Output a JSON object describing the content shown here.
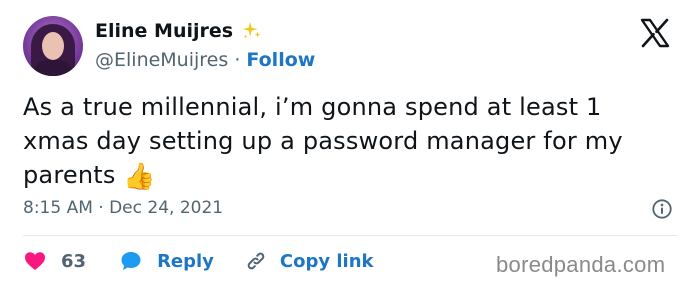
{
  "author": {
    "display_name": "Eline Muijres",
    "handle": "@ElineMuijres",
    "separator": "·",
    "follow_label": "Follow",
    "verified_icon": "sparkle-icon"
  },
  "tweet": {
    "text": "As a true millennial, i’m gonna spend at least 1 xmas day setting up a password manager for my parents",
    "emoji": "👍",
    "timestamp": "8:15 AM · Dec 24, 2021"
  },
  "actions": {
    "like_count": "63",
    "reply_label": "Reply",
    "copy_link_label": "Copy link"
  },
  "watermark": "boredpanda.com",
  "colors": {
    "heart": "#f91880",
    "link": "#1d77c5",
    "muted": "#536471",
    "text": "#0f1419"
  }
}
